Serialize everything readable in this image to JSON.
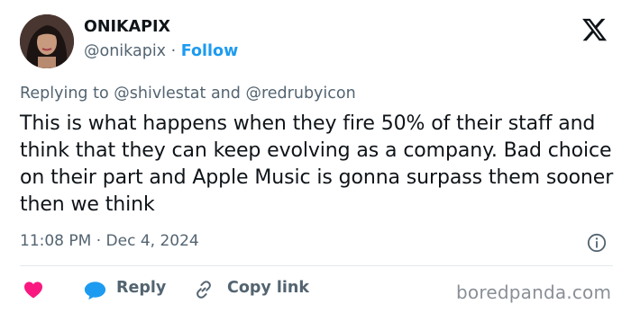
{
  "author": {
    "display_name": "ONIKAPIX",
    "handle": "@onikapix",
    "separator": "·",
    "follow_label": "Follow"
  },
  "reply_context": {
    "prefix": "Replying to",
    "mention_1": "@shivlestat",
    "conjunction": "and",
    "mention_2": "@redrubyicon"
  },
  "tweet": {
    "text": "This is what happens when they fire 50% of their staff and think that they can keep evolving as a company. Bad choice on their part and Apple Music is gonna surpass them sooner then we think",
    "timestamp": "11:08 PM · Dec 4, 2024"
  },
  "actions": {
    "reply_label": "Reply",
    "copy_link_label": "Copy link"
  },
  "watermark": "boredpanda.com",
  "colors": {
    "accent": "#1d9bf0",
    "heart": "#f91880",
    "muted_text": "#536471",
    "text": "#0f1419"
  },
  "icons": [
    "x-logo-icon",
    "info-icon",
    "heart-icon",
    "reply-bubble-icon",
    "link-icon"
  ]
}
